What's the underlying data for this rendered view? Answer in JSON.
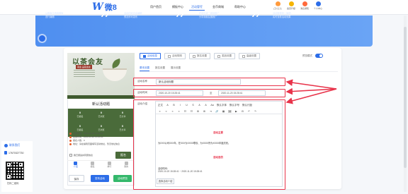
{
  "header": {
    "logo_mark": "W",
    "logo_text": "微8",
    "nav": [
      {
        "label": "用户首页",
        "active": false
      },
      {
        "label": "模板中心",
        "active": false
      },
      {
        "label": "活动管理",
        "active": true
      },
      {
        "label": "金币商城",
        "active": false
      },
      {
        "label": "帮助中心",
        "active": false
      }
    ],
    "right_icons": [
      {
        "label": "扫码登录",
        "icon": "qr-scan-icon",
        "color": "#ff9a3c"
      },
      {
        "label": "会员升级",
        "icon": "crown-icon",
        "color": "#f5b400"
      },
      {
        "label": "消息通知",
        "icon": "bell-icon",
        "color": "#ff6a3c"
      },
      {
        "label": "个人中心",
        "icon": "user-icon",
        "color": "#2c6de8"
      }
    ]
  },
  "banner": {
    "steps": [
      {
        "title": "1.活动模板",
        "desc": "从模板中选择模板\n进行编辑"
      },
      {
        "title": "2.活动编辑",
        "desc": "活动内容自由编辑\n预览即可发布"
      },
      {
        "title": "3.推广活动",
        "desc": "在线生成二维码推广\n分享到朋友圈推广"
      },
      {
        "title": "4.活动数据",
        "desc": "活动数据统一管理，\n实时查看活动效果"
      }
    ]
  },
  "preview": {
    "poster_title": "以茶会友",
    "poster_badge": "茶会 品茗会友",
    "activity_title": "新认活动题",
    "stats": [
      {
        "num": "0",
        "label": "已报名"
      },
      {
        "num": "0",
        "label": "已浏览"
      },
      {
        "num": "0",
        "label": "已分享"
      },
      {
        "num": "0",
        "label": "已报名"
      },
      {
        "num": "0",
        "label": "已浏览"
      },
      {
        "num": "0",
        "label": "已分享"
      }
    ],
    "info": [
      "活动时间：2020-10-20 15:28:41",
      "结束时间：2020-11-20 15:28:41",
      "报名人数：0",
      "地址：请在编辑页面填写活动地址，暂无地址信息"
    ],
    "agree_text": "我已阅读并同意协议",
    "signup_label": "报名",
    "tabs": [
      {
        "label": "介绍",
        "active": true
      },
      {
        "label": "报名",
        "active": false
      },
      {
        "label": "排行",
        "active": false
      },
      {
        "label": "我的",
        "active": false
      }
    ],
    "bottom_buttons": {
      "save": "保存",
      "publish": "发布活动",
      "preview": "活动预览"
    }
  },
  "editor": {
    "top_tabs": [
      {
        "label": "活动信息",
        "active": true
      },
      {
        "label": "活动规则",
        "active": false
      },
      {
        "label": "报名设置",
        "active": false
      },
      {
        "label": "奖品设置",
        "active": false
      },
      {
        "label": "高级设置",
        "active": false
      }
    ],
    "preview_toggle_label": "预览模式",
    "sub_tabs": [
      {
        "label": "基本设置",
        "active": true
      },
      {
        "label": "报名设置",
        "active": false
      },
      {
        "label": "展示设置",
        "active": false
      }
    ],
    "name_label": "活动名称",
    "name_value": "新认活动标题",
    "time_label": "活动时间",
    "time_start": "2020-10-20 15:28:41",
    "time_sep": "至",
    "time_end": "2020-11-20 15:28:41",
    "content_label": "活动介绍",
    "toolbar_row1": [
      "正文",
      "A",
      "B",
      "I",
      "U",
      "S",
      "A",
      "A",
      "Aa",
      "默认字体",
      "默认字号",
      "默认行距"
    ],
    "toolbar_row2": [
      "≡",
      "≡",
      "≡",
      "≡",
      "☷",
      "☷",
      "⊞",
      "⊞",
      "⇥",
      "🔗",
      "▦",
      "🖼",
      "▶",
      "⊟",
      "↶",
      "↷"
    ],
    "content_title1": "活动主要",
    "content_line1": "为XXX公司XXX年，在XXX为XXXX联欢、为XXXX所为XXXX年度庆祝。",
    "content_title2": "活动目的",
    "content_line2": "活动时间：",
    "content_line3": "2020-10-20 15:28:41 ~ 2020-11-20 15:28:41",
    "template_button": "选择活动介绍"
  },
  "sidebar": {
    "kefu_label": "联系我们",
    "phone": "17670327730",
    "qr_label": "扫码二维码"
  },
  "colors": {
    "brand": "#2c6de8",
    "highlight": "#e8334a",
    "poster_green": "#4a6b3a"
  }
}
